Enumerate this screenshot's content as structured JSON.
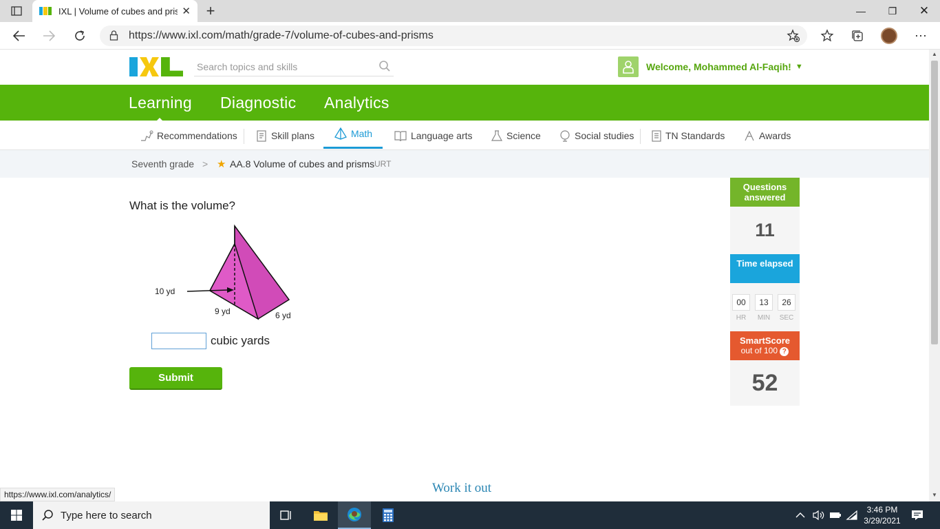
{
  "browser": {
    "tab_title": "IXL | Volume of cubes and prisms",
    "url": "https://www.ixl.com/math/grade-7/volume-of-cubes-and-prisms",
    "status_url": "https://www.ixl.com/analytics/"
  },
  "header": {
    "search_placeholder": "Search topics and skills",
    "welcome": "Welcome, Mohammed Al-Faqih!"
  },
  "main_nav": [
    "Learning",
    "Diagnostic",
    "Analytics"
  ],
  "sub_nav": [
    "Recommendations",
    "Skill plans",
    "Math",
    "Language arts",
    "Science",
    "Social studies",
    "TN Standards",
    "Awards"
  ],
  "breadcrumb": {
    "grade": "Seventh grade",
    "skill": "AA.8 Volume of cubes and prisms",
    "code": "URT"
  },
  "question": {
    "prompt": "What is the volume?",
    "labels": {
      "height": "10 yd",
      "base": "9 yd",
      "length": "6 yd"
    },
    "answer_value": "",
    "unit": "cubic yards",
    "submit": "Submit",
    "work_it_out": "Work it out"
  },
  "stats": {
    "questions_label": "Questions answered",
    "questions_value": "11",
    "time_label": "Time elapsed",
    "hr": "00",
    "min": "13",
    "sec": "26",
    "hr_label": "HR",
    "min_label": "MIN",
    "sec_label": "SEC",
    "smartscore_label": "SmartScore",
    "smartscore_sub": "out of 100",
    "smartscore_value": "52"
  },
  "taskbar": {
    "search": "Type here to search",
    "time": "3:46 PM",
    "date": "3/29/2021"
  },
  "colors": {
    "ixl_green": "#56b40c",
    "prism_pink": "#df5ac7",
    "time_blue": "#1aa5dc",
    "smartscore_orange": "#e5592f"
  }
}
